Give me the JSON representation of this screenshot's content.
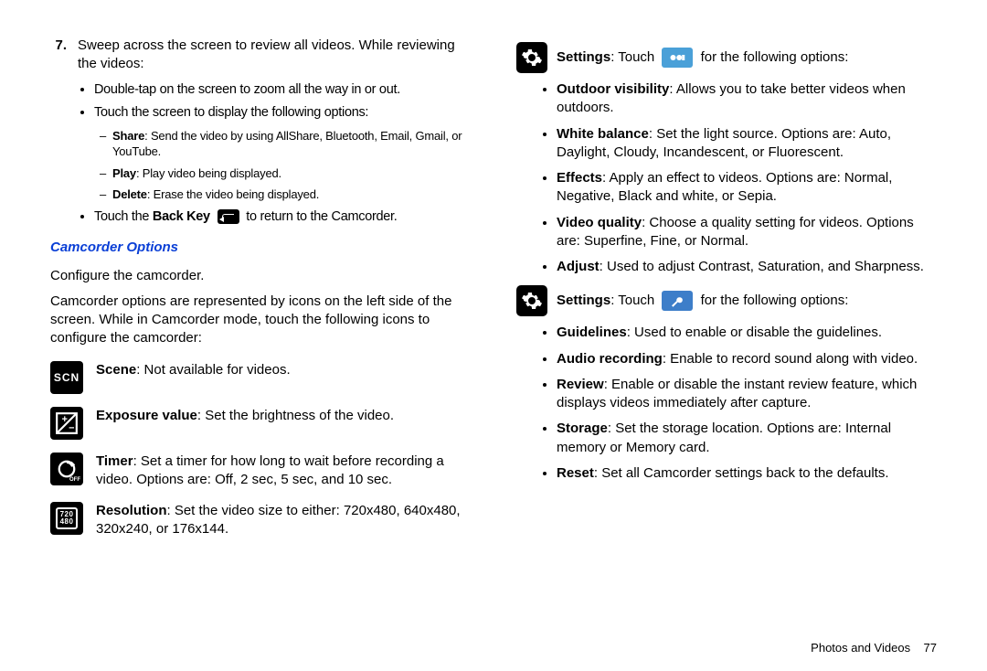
{
  "left": {
    "step_num": "7.",
    "step_text": "Sweep across the screen to review all videos. While reviewing the videos:",
    "b1": "Double-tap on the screen to zoom all the way in or out.",
    "b2": "Touch the screen to display the following options:",
    "d1a": "Share",
    "d1b": ": Send the video by using AllShare, Bluetooth, Email, Gmail, or YouTube.",
    "d2a": "Play",
    "d2b": ": Play video being displayed.",
    "d3a": "Delete",
    "d3b": ": Erase the video being displayed.",
    "b3a": "Touch the ",
    "b3b": "Back Key",
    "b3c": " to return to the Camcorder.",
    "heading": "Camcorder Options",
    "p1": "Configure the camcorder.",
    "p2": "Camcorder options are represented by icons on the left side of the screen. While in Camcorder mode, touch the following icons to configure the camcorder:",
    "r1a": "Scene",
    "r1b": ": Not available for videos.",
    "r2a": "Exposure value",
    "r2b": ": Set the brightness of the video.",
    "r3a": "Timer",
    "r3b": ": Set a timer for how long to wait before recording a video. Options are: Off, 2 sec, 5 sec, and 10 sec.",
    "r4a": "Resolution",
    "r4b": ": Set the video size to either: 720x480, 640x480, 320x240, or 176x144."
  },
  "right": {
    "s1a": "Settings",
    "s1b": ": Touch ",
    "s1c": " for the following options:",
    "b1a": "Outdoor visibility",
    "b1b": ": Allows you to take better videos when outdoors.",
    "b2a": "White balance",
    "b2b": ": Set the light source. Options are: Auto, Daylight, Cloudy, Incandescent, or Fluorescent.",
    "b3a": "Effects",
    "b3b": ": Apply an effect to videos. Options are: Normal, Negative, Black and white, or Sepia.",
    "b4a": "Video quality",
    "b4b": ": Choose a quality setting for videos. Options are: Superfine, Fine, or Normal.",
    "b5a": "Adjust",
    "b5b": ": Used to adjust Contrast, Saturation, and Sharpness.",
    "s2a": "Settings",
    "s2b": ": Touch ",
    "s2c": " for the following options:",
    "c1a": "Guidelines",
    "c1b": ": Used to enable or disable the guidelines.",
    "c2a": "Audio recording",
    "c2b": ": Enable to record sound along with video.",
    "c3a": "Review",
    "c3b": ": Enable or disable the instant review feature, which displays videos immediately after capture.",
    "c4a": "Storage",
    "c4b": ": Set the storage location. Options are: Internal memory or Memory card.",
    "c5a": "Reset",
    "c5b": ": Set all Camcorder settings back to the defaults."
  },
  "footer": {
    "section": "Photos and Videos",
    "page": "77"
  }
}
